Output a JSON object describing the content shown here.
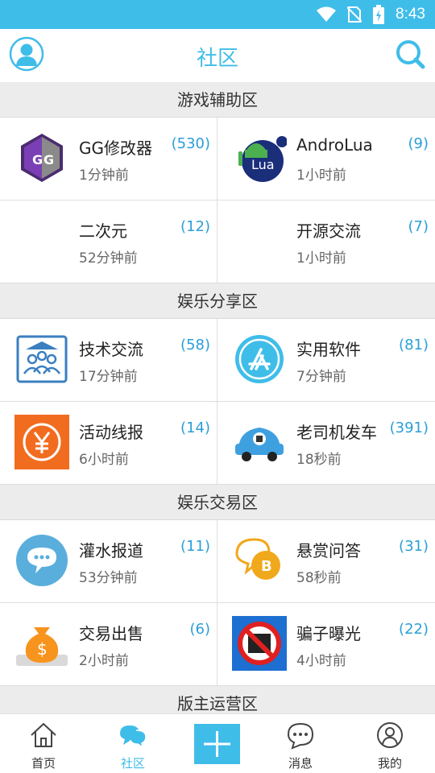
{
  "status_bar": {
    "time": "8:43",
    "icons": [
      "wifi-icon",
      "no-sim-icon",
      "battery-charging-icon"
    ]
  },
  "app_bar": {
    "title": "社区",
    "left_icon": "avatar-icon",
    "right_icon": "search-icon"
  },
  "sections": [
    {
      "title": "游戏辅助区",
      "boards": [
        {
          "name": "GG修改器",
          "count": "(530)",
          "time": "1分钟前",
          "icon": "gg-modifier-icon"
        },
        {
          "name": "AndroLua",
          "count": "(9)",
          "time": "1小时前",
          "icon": "androlua-icon"
        },
        {
          "name": "二次元",
          "count": "(12)",
          "time": "52分钟前",
          "icon": ""
        },
        {
          "name": "开源交流",
          "count": "(7)",
          "time": "1小时前",
          "icon": ""
        }
      ]
    },
    {
      "title": "娱乐分享区",
      "boards": [
        {
          "name": "技术交流",
          "count": "(58)",
          "time": "17分钟前",
          "icon": "tech-exchange-icon"
        },
        {
          "name": "实用软件",
          "count": "(81)",
          "time": "7分钟前",
          "icon": "app-store-icon"
        },
        {
          "name": "活动线报",
          "count": "(14)",
          "time": "6小时前",
          "icon": "yuan-coin-icon"
        },
        {
          "name": "老司机发车",
          "count": "(391)",
          "time": "18秒前",
          "icon": "car-icon"
        }
      ]
    },
    {
      "title": "娱乐交易区",
      "boards": [
        {
          "name": "灌水报道",
          "count": "(11)",
          "time": "53分钟前",
          "icon": "chat-bubble-icon"
        },
        {
          "name": "悬赏问答",
          "count": "(31)",
          "time": "58秒前",
          "icon": "bitcoin-chat-icon"
        },
        {
          "name": "交易出售",
          "count": "(6)",
          "time": "2小时前",
          "icon": "money-bag-icon"
        },
        {
          "name": "骗子曝光",
          "count": "(22)",
          "time": "4小时前",
          "icon": "no-scam-icon"
        }
      ]
    },
    {
      "title": "版主运营区",
      "boards": []
    }
  ],
  "bottom_nav": {
    "home": "首页",
    "community": "社区",
    "messages": "消息",
    "mine": "我的",
    "active": "community"
  },
  "colors": {
    "accent": "#3fbde9",
    "count": "#2a9fd8"
  }
}
